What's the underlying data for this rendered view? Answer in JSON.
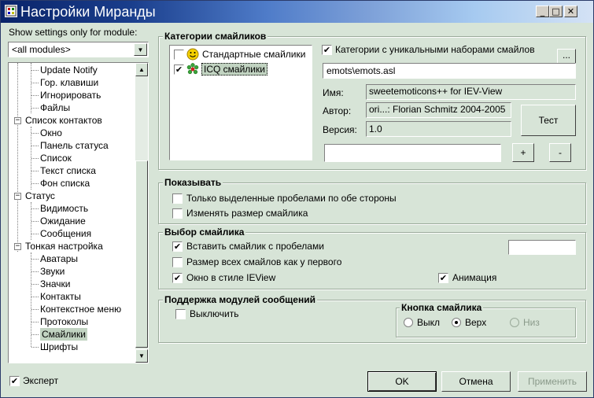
{
  "window": {
    "title": "Настройки Миранды",
    "min": "_",
    "max": "□",
    "close": "✕"
  },
  "left": {
    "filter_label": "Show settings only for module:",
    "module_select": "<all modules>",
    "tree": [
      {
        "label": "Update Notify",
        "level": 1
      },
      {
        "label": "Гор. клавиши",
        "level": 1
      },
      {
        "label": "Игнорировать",
        "level": 1
      },
      {
        "label": "Файлы",
        "level": 1
      },
      {
        "label": "Список контактов",
        "level": 0
      },
      {
        "label": "Окно",
        "level": 1
      },
      {
        "label": "Панель статуса",
        "level": 1
      },
      {
        "label": "Список",
        "level": 1
      },
      {
        "label": "Текст списка",
        "level": 1
      },
      {
        "label": "Фон списка",
        "level": 1
      },
      {
        "label": "Статус",
        "level": 0
      },
      {
        "label": "Видимость",
        "level": 1
      },
      {
        "label": "Ожидание",
        "level": 1
      },
      {
        "label": "Сообщения",
        "level": 1
      },
      {
        "label": "Тонкая настройка",
        "level": 0
      },
      {
        "label": "Аватары",
        "level": 1
      },
      {
        "label": "Звуки",
        "level": 1
      },
      {
        "label": "Значки",
        "level": 1
      },
      {
        "label": "Контакты",
        "level": 1
      },
      {
        "label": "Контекстное меню",
        "level": 1
      },
      {
        "label": "Протоколы",
        "level": 1
      },
      {
        "label": "Смайлики",
        "level": 1
      },
      {
        "label": "Шрифты",
        "level": 1
      }
    ],
    "expert_label": "Эксперт",
    "expert_checked": true
  },
  "categories": {
    "title": "Категории смайликов",
    "list": [
      {
        "label": "Стандартные смайлики",
        "checked": false
      },
      {
        "label": "ICQ смайлики",
        "checked": true
      }
    ],
    "unique_label": "Категории с уникальными наборами смайлов",
    "unique_checked": true,
    "browse_label": "...",
    "path": "emots\\emots.asl",
    "name_label": "Имя:",
    "name_value": "sweetemoticons++ for IEV-View",
    "author_label": "Автор:",
    "author_value": "ori...: Florian Schmitz 2004-2005",
    "version_label": "Версия:",
    "version_value": "1.0",
    "test_label": "Тест",
    "new_category": "",
    "add_label": "+",
    "remove_label": "-"
  },
  "show": {
    "title": "Показывать",
    "opt1": "Только выделенные пробелами по обе стороны",
    "opt1_checked": false,
    "opt2": "Изменять размер смайлика",
    "opt2_checked": false
  },
  "select": {
    "title": "Выбор смайлика",
    "opt1": "Вставить смайлик с пробелами",
    "opt1_checked": true,
    "opt2": "Размер всех смайлов как у первого",
    "opt2_checked": false,
    "opt3": "Окно в стиле IEView",
    "opt3_checked": true,
    "anim": "Анимация",
    "anim_checked": true,
    "text_value": ""
  },
  "modules": {
    "title": "Поддержка модулей сообщений",
    "disable": "Выключить",
    "disable_checked": false,
    "button_group": "Кнопка смайлика",
    "radio_off": "Выкл",
    "radio_top": "Верх",
    "radio_bottom": "Низ",
    "selected": "Верх"
  },
  "footer": {
    "ok": "OK",
    "cancel": "Отмена",
    "apply": "Применить"
  },
  "colors": {
    "bg": "#d7e4d7",
    "title_start": "#0a246a",
    "title_end": "#d4e2f5",
    "selection": "#c1d3c1"
  }
}
